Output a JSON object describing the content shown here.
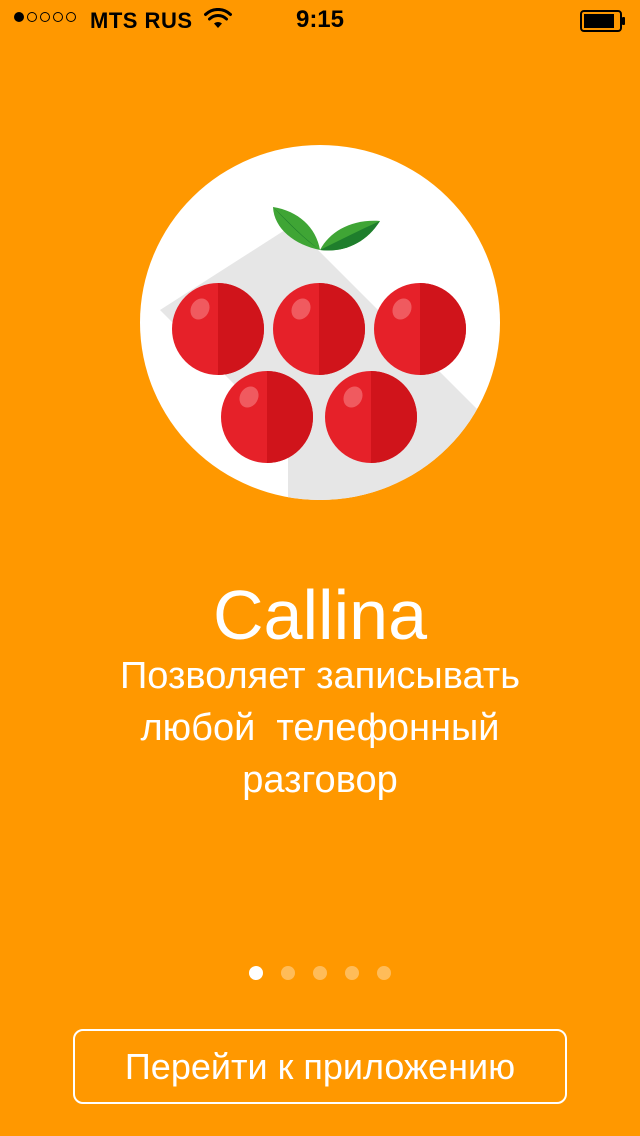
{
  "status_bar": {
    "carrier": "MTS RUS",
    "time": "9:15",
    "signal_bars_filled": 1,
    "signal_bars_total": 5,
    "wifi_icon": "wifi-icon",
    "battery_icon": "battery-icon"
  },
  "onboarding": {
    "logo_icon": "raspberry-logo-icon",
    "title": "Callina",
    "subtitle_lines": [
      "Позволяет записывать",
      "любой  телефонный",
      "разговор"
    ],
    "page_count": 5,
    "current_page": 1,
    "cta_label": "Перейти к приложению"
  },
  "colors": {
    "background": "#FF9800",
    "berry": "#E62129",
    "berry_dark": "#D0141B",
    "leaf": "#3FA535",
    "leaf_dark": "#1E7E2C",
    "text": "#FFFFFF"
  }
}
